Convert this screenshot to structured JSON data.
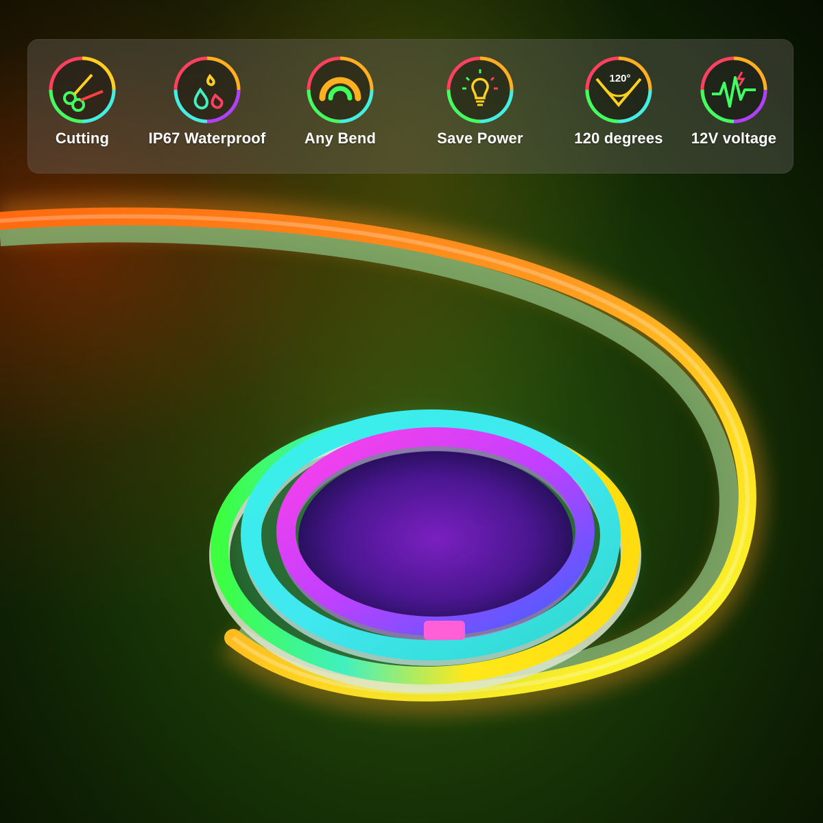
{
  "features": [
    {
      "label": "Cutting",
      "icon": "scissors-icon"
    },
    {
      "label": "IP67 Waterproof",
      "icon": "water-drops-icon"
    },
    {
      "label": "Any Bend",
      "icon": "bend-arc-icon"
    },
    {
      "label": "Save Power",
      "icon": "lightbulb-icon"
    },
    {
      "label": "120 degrees",
      "icon": "angle-120-icon",
      "icon_text": "120°"
    },
    {
      "label": "12V voltage",
      "icon": "voltage-wave-icon"
    }
  ],
  "colors": {
    "strip_orange": "#ff7a1a",
    "strip_yellow": "#ffe21a",
    "strip_green": "#4cff2a",
    "strip_cyan": "#3ff0e0",
    "strip_blue": "#3a6bff",
    "strip_purple": "#a040ff",
    "strip_magenta": "#ff3df0",
    "label_text": "#ffffff"
  }
}
